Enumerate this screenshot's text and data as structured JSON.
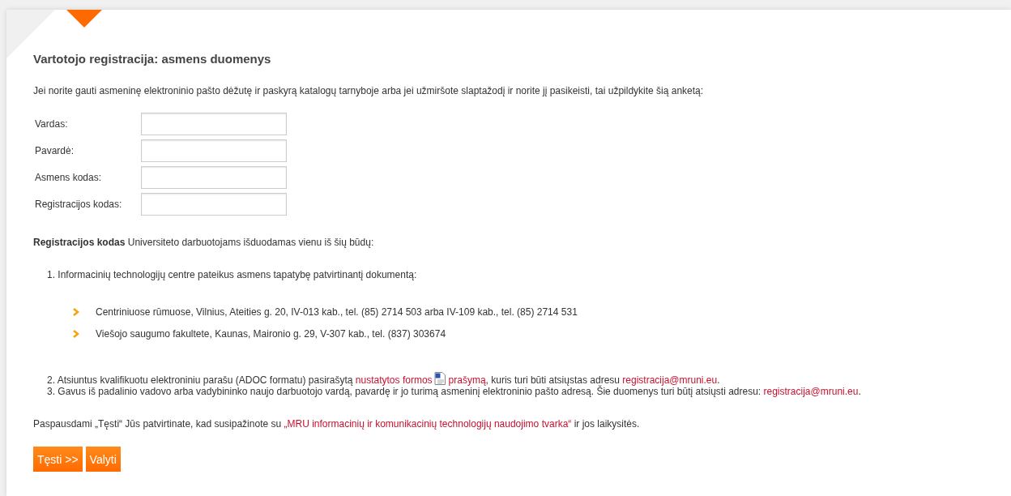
{
  "title": "Vartotojo registracija: asmens duomenys",
  "intro": "Jei norite gauti asmeninę elektroninio pašto dėžutę ir paskyrą katalogų tarnyboje arba jei užmiršote slaptažodį ir norite jį pasikeisti, tai užpildykite šią anketą:",
  "fields": [
    {
      "label": "Vardas:"
    },
    {
      "label": "Pavardė:"
    },
    {
      "label": "Asmens kodas:"
    },
    {
      "label": "Registracijos kodas:"
    }
  ],
  "note": "**Registracijos kodas** Universiteto darbuotojams išduodamas vienu iš šių būdų:",
  "steps": [
    {
      "number": "1.",
      "parts": [
        {
          "kind": "text",
          "text": "Informacinių technologijų centre pateikus asmens tapatybę patvirtinantį dokumentą:"
        }
      ],
      "locations": [
        "Centriniuose rūmuose, Vilnius, Ateities g. 20, IV-013 kab., tel. (85) 2714 503 arba IV-109 kab., tel. (85) 2714 531",
        "Viešojo saugumo fakultete, Kaunas, Maironio g. 29, V-307 kab., tel. (837) 303674"
      ]
    },
    {
      "number": "2.",
      "parts": [
        {
          "kind": "text",
          "text": "Atsiuntus kvalifikuotu elektroniniu parašu (ADOC formatu) pasirašytą "
        },
        {
          "kind": "link",
          "text": "nustatytos formos"
        },
        {
          "kind": "icon"
        },
        {
          "kind": "link",
          "text": "prašymą"
        },
        {
          "kind": "text",
          "text": ", kuris turi būti atsiųstas adresu "
        },
        {
          "kind": "link",
          "text": "registracija@mruni.eu"
        },
        {
          "kind": "text",
          "text": "."
        }
      ]
    },
    {
      "number": "3.",
      "parts": [
        {
          "kind": "text",
          "text": "Gavus iš padalinio vadovo arba vadybininko naujo darbuotojo vardą, pavardę ir jo turimą asmeninį elektroninio pašto adresą. Šie duomenys turi būtį atsiųsti adresu: "
        },
        {
          "kind": "link",
          "text": "registracija@mruni.eu"
        },
        {
          "kind": "text",
          "text": "."
        }
      ]
    }
  ],
  "consent": [
    {
      "kind": "text",
      "text": "Paspausdami „Tęsti“ Jūs patvirtinate, kad susipažinote su "
    },
    {
      "kind": "link",
      "text": "„MRU informacinių ir komunikacinių technologijų naudojimo tvarka“"
    },
    {
      "kind": "text",
      "text": " ir jos laikysitės."
    }
  ],
  "buttons": [
    "Tęsti >>",
    "Valyti"
  ]
}
